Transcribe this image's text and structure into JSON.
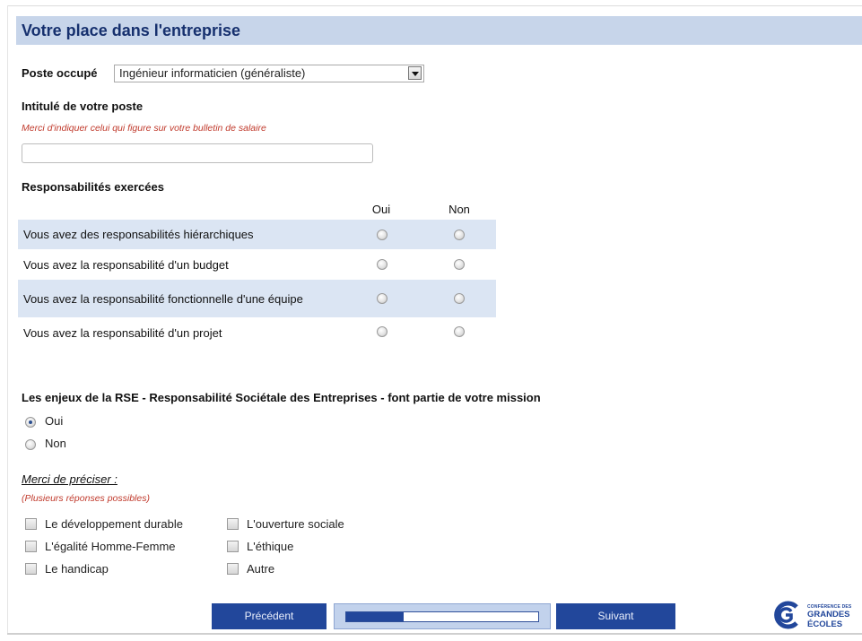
{
  "section": {
    "title": "Votre place dans l'entreprise"
  },
  "poste": {
    "label": "Poste occupé",
    "selected": "Ingénieur informaticien (généraliste)"
  },
  "intitule": {
    "label": "Intitulé de votre poste",
    "hint": "Merci d'indiquer celui qui figure sur votre bulletin de salaire",
    "value": ""
  },
  "responsabilites": {
    "label": "Responsabilités exercées",
    "col_oui": "Oui",
    "col_non": "Non",
    "rows": [
      {
        "text": "Vous avez des responsabilités hiérarchiques"
      },
      {
        "text": "Vous avez la responsabilité d'un budget"
      },
      {
        "text": "Vous avez la responsabilité fonctionnelle d'une équipe"
      },
      {
        "text": "Vous avez la responsabilité d'un projet"
      }
    ]
  },
  "rse": {
    "question": "Les enjeux de la RSE - Responsabilité Sociétale des Entreprises - font partie de votre mission",
    "options": [
      {
        "label": "Oui",
        "checked": true
      },
      {
        "label": "Non",
        "checked": false
      }
    ],
    "precise_label": "Merci de préciser :",
    "multi_hint": "(Plusieurs réponses possibles)",
    "checkboxes": [
      {
        "label": "Le développement durable",
        "checked": false
      },
      {
        "label": "L'égalité Homme-Femme",
        "checked": false
      },
      {
        "label": "Le handicap",
        "checked": false
      },
      {
        "label": "L'ouverture sociale",
        "checked": false
      },
      {
        "label": "L'éthique",
        "checked": false
      },
      {
        "label": "Autre",
        "checked": false
      }
    ]
  },
  "footer": {
    "prev_label": "Précédent",
    "next_label": "Suivant",
    "progress_fraction": 0.3
  },
  "logo": {
    "line1": "CONFÉRENCE DES",
    "line2": "GRANDES",
    "line3": "ÉCOLES"
  },
  "colors": {
    "header_bg": "#c7d5ea",
    "title_color": "#16306e",
    "button_bg": "#22479b",
    "row_shade": "#dbe5f3",
    "hint_red": "#c0392b"
  }
}
